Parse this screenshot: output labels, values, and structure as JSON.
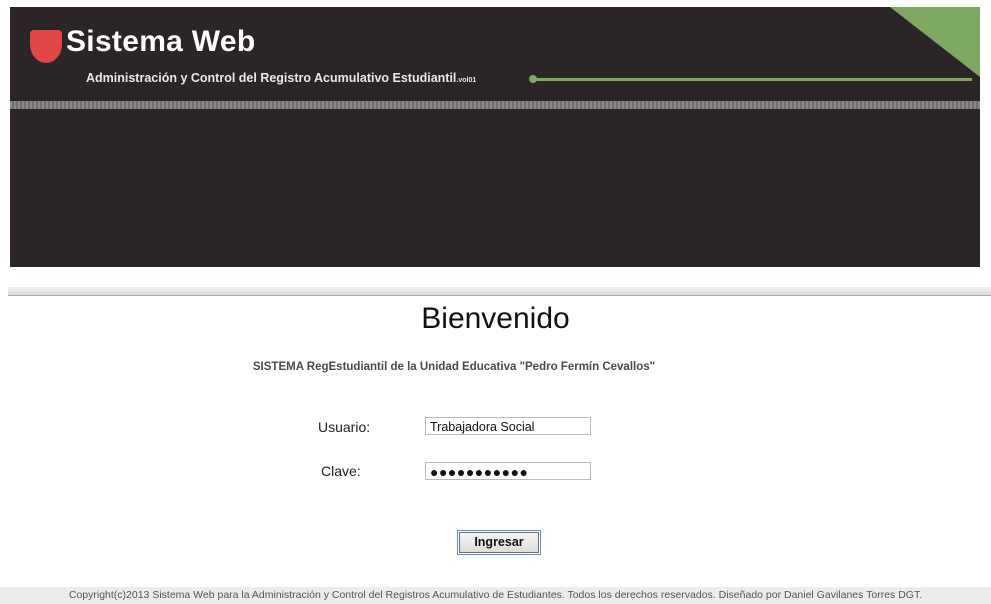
{
  "header": {
    "title": "Sistema Web",
    "subtitle": "Administración y Control del Registro Acumulativo Estudiantil",
    "version": ".vol01"
  },
  "main": {
    "welcome": "Bienvenido",
    "description": "SISTEMA RegEstudiantil de la Unidad Educativa \"Pedro Fermín Cevallos\""
  },
  "form": {
    "user_label": "Usuario:",
    "user_value": "Trabajadora Social",
    "password_label": "Clave:",
    "password_value": "●●●●●●●●●●●",
    "submit_label": "Ingresar"
  },
  "footer": {
    "copyright": "Copyright(c)2013 Sistema Web para la Administración y Control del Registros Acumulativo de Estudiantes. Todos los derechos reservados. Diseñado por Daniel Gavilanes Torres DGT."
  },
  "colors": {
    "header_bg": "#2b2527",
    "logo": "#e04848",
    "accent_green": "#7ea862"
  },
  "icons": {
    "logo": "logo-icon"
  }
}
